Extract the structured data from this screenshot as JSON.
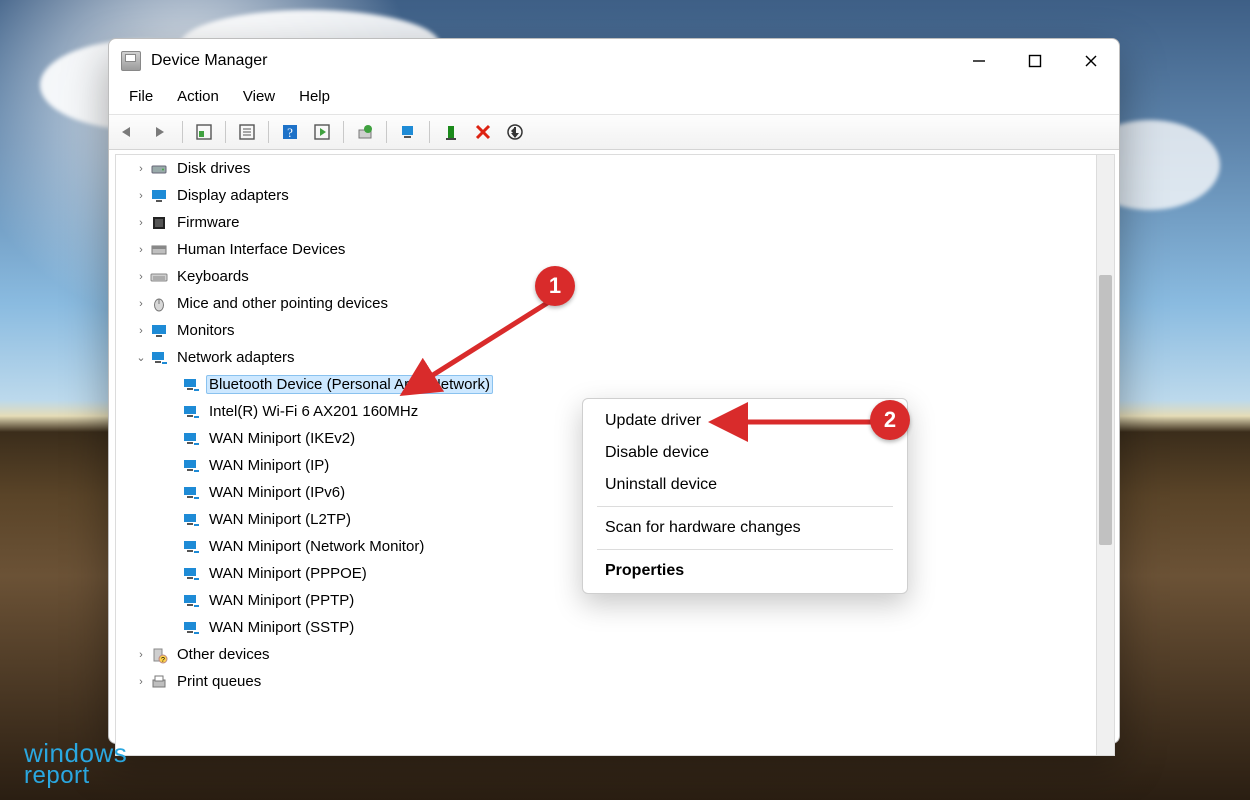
{
  "window": {
    "title": "Device Manager"
  },
  "menubar": [
    "File",
    "Action",
    "View",
    "Help"
  ],
  "tree": {
    "categories": [
      {
        "exp": "›",
        "icon": "disk",
        "label": "Disk drives"
      },
      {
        "exp": "›",
        "icon": "display",
        "label": "Display adapters"
      },
      {
        "exp": "›",
        "icon": "firmware",
        "label": "Firmware"
      },
      {
        "exp": "›",
        "icon": "hid",
        "label": "Human Interface Devices"
      },
      {
        "exp": "›",
        "icon": "keyboard",
        "label": "Keyboards"
      },
      {
        "exp": "›",
        "icon": "mouse",
        "label": "Mice and other pointing devices"
      },
      {
        "exp": "›",
        "icon": "monitor",
        "label": "Monitors"
      },
      {
        "exp": "⌄",
        "icon": "network",
        "label": "Network adapters",
        "expanded": true,
        "children": [
          {
            "icon": "network",
            "label": "Bluetooth Device (Personal Area Network)",
            "selected": true
          },
          {
            "icon": "network",
            "label": "Intel(R) Wi-Fi 6 AX201 160MHz"
          },
          {
            "icon": "network",
            "label": "WAN Miniport (IKEv2)"
          },
          {
            "icon": "network",
            "label": "WAN Miniport (IP)"
          },
          {
            "icon": "network",
            "label": "WAN Miniport (IPv6)"
          },
          {
            "icon": "network",
            "label": "WAN Miniport (L2TP)"
          },
          {
            "icon": "network",
            "label": "WAN Miniport (Network Monitor)"
          },
          {
            "icon": "network",
            "label": "WAN Miniport (PPPOE)"
          },
          {
            "icon": "network",
            "label": "WAN Miniport (PPTP)"
          },
          {
            "icon": "network",
            "label": "WAN Miniport (SSTP)"
          }
        ]
      },
      {
        "exp": "›",
        "icon": "other",
        "label": "Other devices"
      },
      {
        "exp": "›",
        "icon": "printq",
        "label": "Print queues"
      }
    ]
  },
  "context_menu": {
    "items": [
      {
        "label": "Update driver"
      },
      {
        "label": "Disable device"
      },
      {
        "label": "Uninstall device"
      },
      {
        "sep": true
      },
      {
        "label": "Scan for hardware changes"
      },
      {
        "sep": true
      },
      {
        "label": "Properties",
        "bold": true
      }
    ]
  },
  "annotations": {
    "badge1": "1",
    "badge2": "2"
  },
  "watermark": {
    "line1": "windows",
    "line2": "report"
  }
}
